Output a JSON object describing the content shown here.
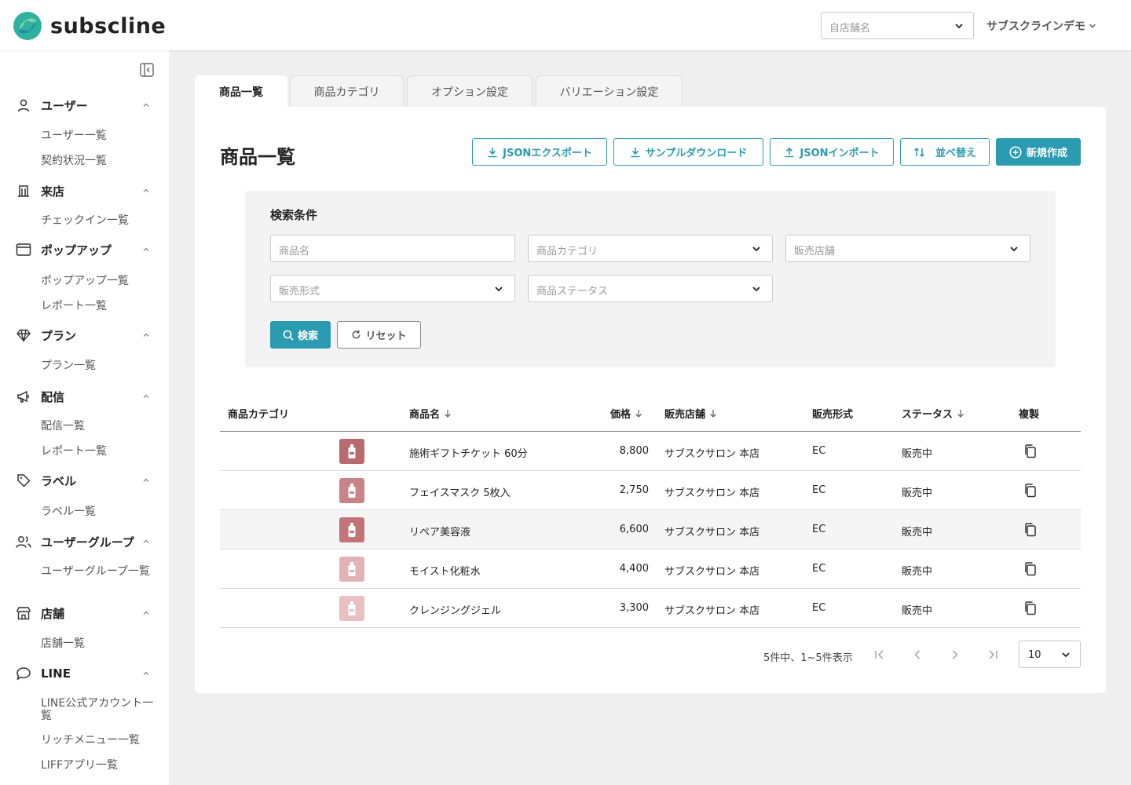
{
  "app": {
    "brand": "subscline",
    "store_placeholder": "自店舗名",
    "account_name": "サブスクラインデモ",
    "accent_color": "#2a9bb0"
  },
  "sidebar": {
    "groups": [
      {
        "label": "ユーザー",
        "icon": "user-icon",
        "items": [
          "ユーザー一覧",
          "契約状況一覧"
        ]
      },
      {
        "label": "来店",
        "icon": "building-icon",
        "items": [
          "チェックイン一覧"
        ]
      },
      {
        "label": "ポップアップ",
        "icon": "window-icon",
        "items": [
          "ポップアップ一覧",
          "レポート一覧"
        ]
      },
      {
        "label": "プラン",
        "icon": "diamond-icon",
        "items": [
          "プラン一覧"
        ]
      },
      {
        "label": "配信",
        "icon": "megaphone-icon",
        "items": [
          "配信一覧",
          "レポート一覧"
        ]
      },
      {
        "label": "ラベル",
        "icon": "tag-icon",
        "items": [
          "ラベル一覧"
        ]
      },
      {
        "label": "ユーザーグループ",
        "icon": "users-icon",
        "items": [
          "ユーザーグループ一覧"
        ]
      },
      {
        "label": "店舗",
        "icon": "store-icon",
        "items": [
          "店舗一覧"
        ]
      },
      {
        "label": "LINE",
        "icon": "chat-bubble-icon",
        "items": [
          "LINE公式アカウント一覧",
          "リッチメニュー一覧",
          "LIFFアプリ一覧"
        ]
      }
    ]
  },
  "tabs": [
    "商品一覧",
    "商品カテゴリ",
    "オプション設定",
    "バリエーション設定"
  ],
  "page": {
    "title": "商品一覧",
    "actions": [
      "JSONエクスポート",
      "サンプルダウンロード",
      "JSONインポート",
      "並べ替え",
      "新規作成"
    ]
  },
  "search": {
    "title": "検索条件",
    "fields": [
      "商品名",
      "商品カテゴリ",
      "販売店舗",
      "販売形式",
      "商品ステータス"
    ],
    "search_label": "検索",
    "reset_label": "リセット"
  },
  "table": {
    "headers": [
      "商品カテゴリ",
      "商品名",
      "価格",
      "販売店舗",
      "販売形式",
      "ステータス",
      "複製"
    ],
    "rows": [
      {
        "category": "",
        "name": "施術ギフトチケット 60分",
        "price": "8,800",
        "store": "サブスクサロン 本店",
        "type": "EC",
        "status": "販売中",
        "thumb_color": "#b86a6f"
      },
      {
        "category": "",
        "name": "フェイスマスク 5枚入",
        "price": "2,750",
        "store": "サブスクサロン 本店",
        "type": "EC",
        "status": "販売中",
        "thumb_color": "#c98488"
      },
      {
        "category": "",
        "name": "リペア美容液",
        "price": "6,600",
        "store": "サブスクサロン 本店",
        "type": "EC",
        "status": "販売中",
        "thumb_color": "#c27479"
      },
      {
        "category": "",
        "name": "モイスト化粧水",
        "price": "4,400",
        "store": "サブスクサロン 本店",
        "type": "EC",
        "status": "販売中",
        "thumb_color": "#e2b3b5"
      },
      {
        "category": "",
        "name": "クレンジングジェル",
        "price": "3,300",
        "store": "サブスクサロン 本店",
        "type": "EC",
        "status": "販売中",
        "thumb_color": "#e8c0c1"
      }
    ]
  },
  "pagination": {
    "summary": "5件中、1~5件表示",
    "per_page": "10"
  }
}
